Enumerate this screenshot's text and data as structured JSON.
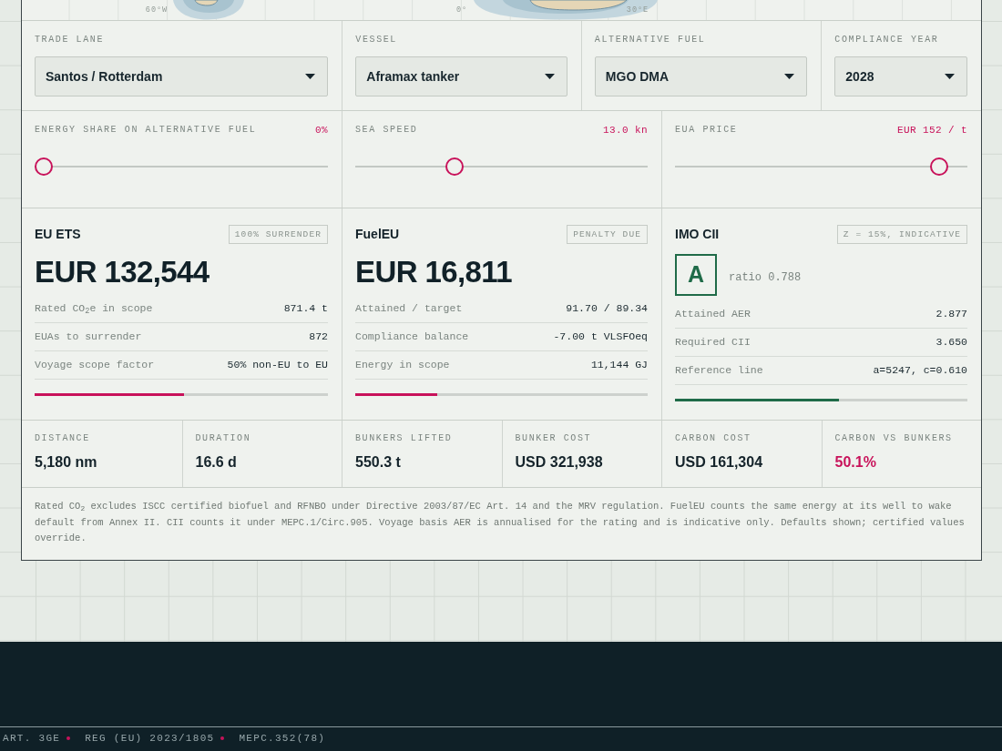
{
  "map": {
    "longitude_labels": [
      "60°W",
      "0°",
      "30°E"
    ]
  },
  "selectors": [
    {
      "label": "TRADE LANE",
      "value": "Santos / Rotterdam"
    },
    {
      "label": "VESSEL",
      "value": "Aframax tanker"
    },
    {
      "label": "ALTERNATIVE FUEL",
      "value": "MGO DMA"
    },
    {
      "label": "COMPLIANCE YEAR",
      "value": "2028"
    }
  ],
  "sliders": [
    {
      "label": "ENERGY SHARE ON ALTERNATIVE FUEL",
      "reading": "0%",
      "level": 0
    },
    {
      "label": "SEA SPEED",
      "reading": "13.0 kn",
      "level": 0.33
    },
    {
      "label": "EUA PRICE",
      "reading": "EUR 152 / t",
      "level": 0.93
    }
  ],
  "panels": [
    {
      "kind": "cost",
      "title": "EU ETS",
      "badge": "100% SURRENDER",
      "amount": "EUR 132,544",
      "rows": [
        {
          "label": "Rated CO$_{2}$e in scope",
          "value": "871.4 t"
        },
        {
          "label": "EUAs to surrender",
          "value": "872"
        },
        {
          "label": "Voyage scope factor",
          "value": "50% non-EU to EU"
        }
      ],
      "progress": {
        "level": 0.51,
        "color": "#c8125a"
      }
    },
    {
      "kind": "cost",
      "title": "FuelEU",
      "badge": "PENALTY DUE",
      "amount": "EUR 16,811",
      "rows": [
        {
          "label": "Attained / target",
          "value": "91.70 / 89.34"
        },
        {
          "label": "Compliance balance",
          "value": "-7.00 t VLSFOeq"
        },
        {
          "label": "Energy in scope",
          "value": "11,144 GJ"
        }
      ],
      "progress": {
        "level": 0.28,
        "color": "#c8125a"
      }
    },
    {
      "kind": "rating",
      "title": "IMO CII",
      "badge": "Z = 15%, INDICATIVE",
      "grade": "A",
      "ratio": "ratio 0.788",
      "rows": [
        {
          "label": "Attained AER",
          "value": "2.877"
        },
        {
          "label": "Required CII",
          "value": "3.650"
        },
        {
          "label": "Reference line",
          "value": "a=5247, c=0.610"
        }
      ],
      "progress": {
        "level": 0.56,
        "color": "#1f6b48"
      }
    }
  ],
  "stats": [
    {
      "label": "DISTANCE",
      "value": "5,180 nm",
      "highlighted": false
    },
    {
      "label": "DURATION",
      "value": "16.6 d",
      "highlighted": false
    },
    {
      "label": "BUNKERS LIFTED",
      "value": "550.3 t",
      "highlighted": false
    },
    {
      "label": "BUNKER COST",
      "value": "USD 321,938",
      "highlighted": false
    },
    {
      "label": "CARBON COST",
      "value": "USD 161,304",
      "highlighted": false
    },
    {
      "label": "CARBON VS BUNKERS",
      "value": "50.1%",
      "highlighted": true
    }
  ],
  "footnote": "Rated CO$_{2}$ excludes ISCC certified biofuel and RFNBO under Directive 2003/87/EC Art. 14 and the MRV regulation. FuelEU counts the same energy at its well to wake default from Annex II. CII counts it under MEPC.1/Circ.905. Voyage basis AER is annualised for the rating and is indicative only. Defaults shown; certified values override.",
  "ticker": [
    "ART. 3GE",
    "REG (EU) 2023/1805",
    "MEPC.352(78)"
  ]
}
